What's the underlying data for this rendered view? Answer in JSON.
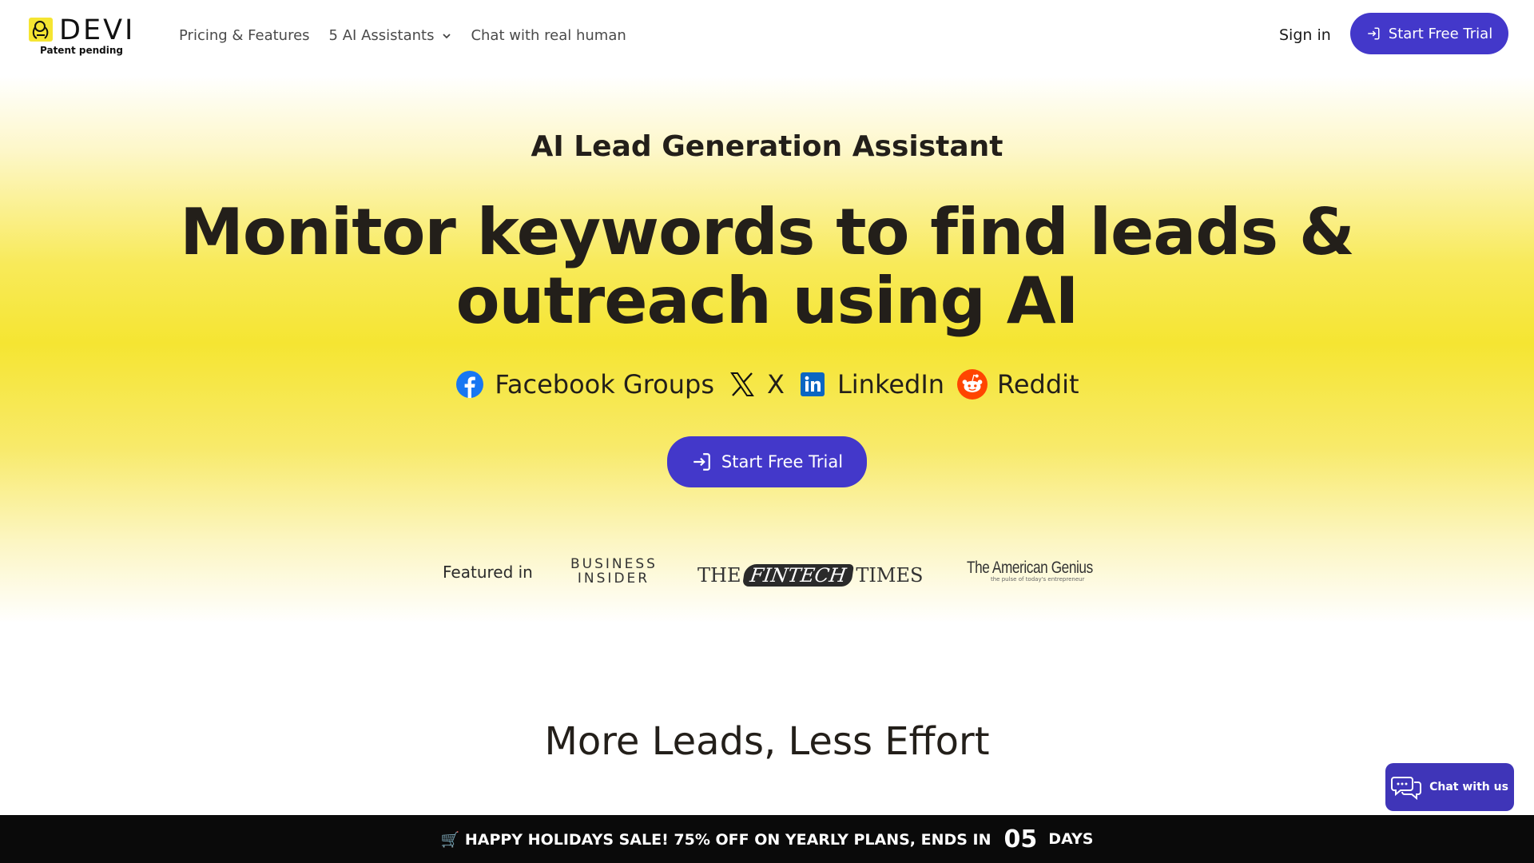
{
  "brand": {
    "name": "DEVI",
    "tagline": "Patent pending"
  },
  "nav": {
    "items": [
      {
        "label": "Pricing & Features"
      },
      {
        "label": "5 AI Assistants"
      },
      {
        "label": "Chat with real human"
      }
    ],
    "signin_label": "Sign in",
    "cta_label": "Start Free Trial"
  },
  "hero": {
    "eyebrow": "AI Lead Generation Assistant",
    "title_line1": "Monitor keywords to find leads &",
    "title_line2": "outreach using AI",
    "platforms": [
      {
        "label": "Facebook Groups",
        "icon": "facebook-icon",
        "color": "#1877f2"
      },
      {
        "label": "X",
        "icon": "x-icon",
        "color": "#111111"
      },
      {
        "label": "LinkedIn",
        "icon": "linkedin-icon",
        "color": "#0a66c2"
      },
      {
        "label": "Reddit",
        "icon": "reddit-icon",
        "color": "#ff4500"
      }
    ],
    "cta_label": "Start Free Trial"
  },
  "featured": {
    "label": "Featured in",
    "press": {
      "business_insider_line1": "BUSINESS",
      "business_insider_line2": "INSIDER",
      "fintech_the": "THE",
      "fintech_mid": "FINTECH",
      "fintech_times": "TIMES",
      "american_genius": "The American Genius",
      "american_genius_sub": "the pulse of today's entrepreneur"
    }
  },
  "section": {
    "title": "More Leads, Less Effort"
  },
  "chat_widget": {
    "label": "Chat with us"
  },
  "promo": {
    "text": "🛒 HAPPY HOLIDAYS SALE! 75% OFF ON YEARLY PLANS, ENDS IN",
    "days_value": "05",
    "days_label": "DAYS"
  },
  "colors": {
    "accent": "#4338ca",
    "hero_yellow": "#f5e532",
    "promo_bg": "#0a0a0a"
  }
}
